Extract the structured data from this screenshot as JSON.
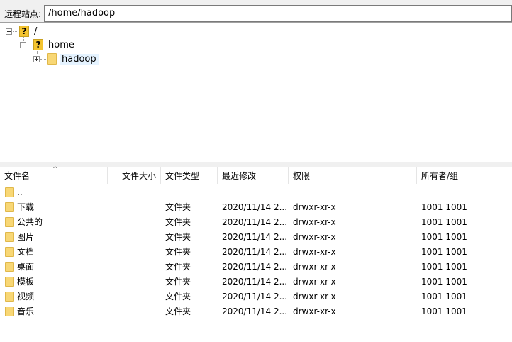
{
  "address": {
    "label": "远程站点:",
    "path": "/home/hadoop"
  },
  "tree": {
    "root": "/",
    "home": "home",
    "hadoop": "hadoop"
  },
  "columns": {
    "name": "文件名",
    "size": "文件大小",
    "type": "文件类型",
    "modified": "最近修改",
    "permissions": "权限",
    "owner": "所有者/组"
  },
  "rows": [
    {
      "name": "..",
      "type": "",
      "modified": "",
      "permissions": "",
      "owner": ""
    },
    {
      "name": "下载",
      "type": "文件夹",
      "modified": "2020/11/14 2...",
      "permissions": "drwxr-xr-x",
      "owner": "1001 1001"
    },
    {
      "name": "公共的",
      "type": "文件夹",
      "modified": "2020/11/14 2...",
      "permissions": "drwxr-xr-x",
      "owner": "1001 1001"
    },
    {
      "name": "图片",
      "type": "文件夹",
      "modified": "2020/11/14 2...",
      "permissions": "drwxr-xr-x",
      "owner": "1001 1001"
    },
    {
      "name": "文档",
      "type": "文件夹",
      "modified": "2020/11/14 2...",
      "permissions": "drwxr-xr-x",
      "owner": "1001 1001"
    },
    {
      "name": "桌面",
      "type": "文件夹",
      "modified": "2020/11/14 2...",
      "permissions": "drwxr-xr-x",
      "owner": "1001 1001"
    },
    {
      "name": "模板",
      "type": "文件夹",
      "modified": "2020/11/14 2...",
      "permissions": "drwxr-xr-x",
      "owner": "1001 1001"
    },
    {
      "name": "视频",
      "type": "文件夹",
      "modified": "2020/11/14 2...",
      "permissions": "drwxr-xr-x",
      "owner": "1001 1001"
    },
    {
      "name": "音乐",
      "type": "文件夹",
      "modified": "2020/11/14 2...",
      "permissions": "drwxr-xr-x",
      "owner": "1001 1001"
    }
  ],
  "colors": {
    "folder": "#f8d775",
    "selection": "#e5f3ff"
  }
}
